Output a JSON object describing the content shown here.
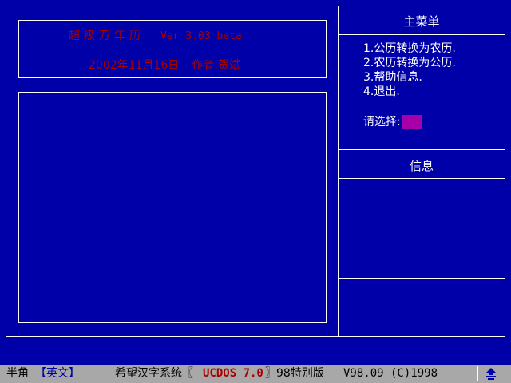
{
  "title": {
    "name": "超级万年历",
    "version": "Ver 3.03 beta",
    "date": "2002年11月16日",
    "author": "作者:贺斌"
  },
  "main_menu": {
    "header": "主菜单",
    "items": [
      {
        "number": "1.",
        "label": "公历转换为农历."
      },
      {
        "number": "2.",
        "label": "农历转换为公历."
      },
      {
        "number": "3.",
        "label": "帮助信息."
      },
      {
        "number": "4.",
        "label": "退出."
      }
    ],
    "prompt": "请选择:"
  },
  "info_panel": {
    "header": "信息"
  },
  "statusbar": {
    "width_mode": "半角",
    "input_mode": "【英文】",
    "system_name": "希望汉字系统〖",
    "ucdos_label": "UCDOS 7.0",
    "edition": "〗98特别版",
    "version": "V98.09 (C)1998",
    "icon": "ucdos-logo-icon"
  },
  "colors": {
    "background": "#0000a8",
    "title_text": "#a80000",
    "border": "#fcfcfc",
    "cursor": "#a800a8",
    "statusbar": "#a8a8a8"
  }
}
